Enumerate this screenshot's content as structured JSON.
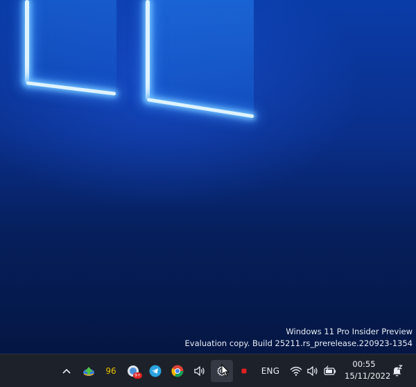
{
  "watermark": {
    "line1": "Windows 11 Pro Insider Preview",
    "line2": "Evaluation copy. Build 25211.rs_prerelease.220923-1354"
  },
  "taskbar": {
    "tray_icons": [
      {
        "name": "show-hidden-icons",
        "icon": "chevron-up-icon"
      },
      {
        "name": "idm-icon",
        "icon": "green-arrow-icon"
      },
      {
        "name": "temperature-indicator",
        "text": "96",
        "color": "#e9c400"
      },
      {
        "name": "chrome-notification-icon",
        "badge": "9+"
      },
      {
        "name": "telegram-icon",
        "icon": "telegram-icon"
      },
      {
        "name": "chrome-icon",
        "icon": "chrome-icon"
      },
      {
        "name": "volume-mixer-icon",
        "icon": "speaker-icon"
      },
      {
        "name": "settings-icon",
        "icon": "gear-icon"
      },
      {
        "name": "recording-indicator",
        "icon": "red-dot-icon"
      }
    ],
    "language": "ENG",
    "clock": {
      "time": "00:55",
      "date": "15/11/2022"
    }
  },
  "colors": {
    "taskbar_bg": "#1d2129",
    "accent_red": "#e02020",
    "indicator_yellow": "#e9c400"
  }
}
